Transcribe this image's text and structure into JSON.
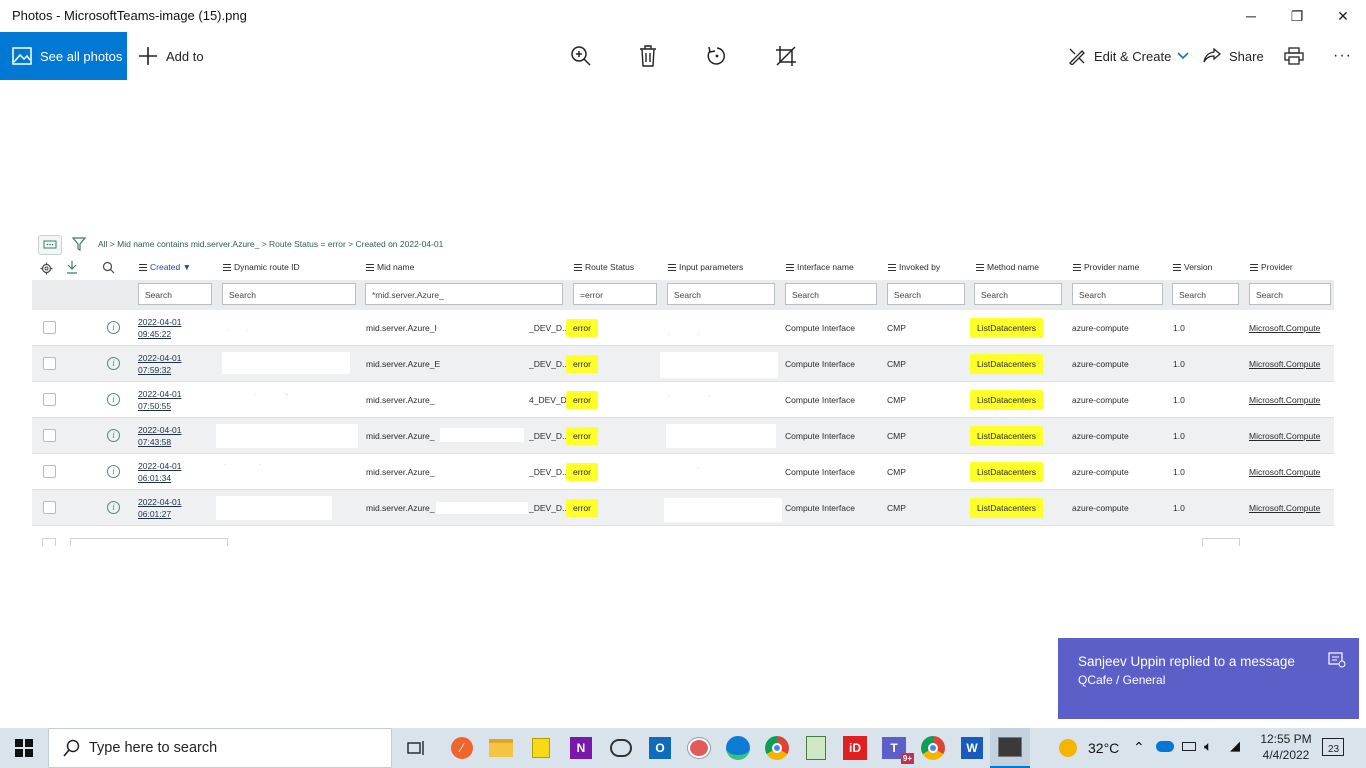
{
  "window": {
    "title": "Photos - MicrosoftTeams-image (15).png",
    "minimize_glyph": "─",
    "maximize_glyph": "❐",
    "close_glyph": "✕"
  },
  "toolbar": {
    "see_all_label": "See all photos",
    "add_to_label": "Add to",
    "edit_create_label": "Edit & Create",
    "share_label": "Share",
    "more_glyph": "···",
    "icons": [
      "zoom-icon",
      "delete-icon",
      "rotate-icon",
      "crop-icon",
      "print-icon"
    ]
  },
  "image": {
    "breadcrumb": "All > Mid name contains mid.server.Azure_ > Route Status = error > Created on 2022-04-01",
    "columns": [
      {
        "key": "created",
        "label": "Created ▼"
      },
      {
        "key": "dynamic_route_id",
        "label": "Dynamic route ID"
      },
      {
        "key": "mid_name",
        "label": "Mid name"
      },
      {
        "key": "route_status",
        "label": "Route Status"
      },
      {
        "key": "input_parameters",
        "label": "Input parameters"
      },
      {
        "key": "interface_name",
        "label": "Interface name"
      },
      {
        "key": "invoked_by",
        "label": "Invoked by"
      },
      {
        "key": "method_name",
        "label": "Method name"
      },
      {
        "key": "provider_name",
        "label": "Provider name"
      },
      {
        "key": "version",
        "label": "Version"
      },
      {
        "key": "provider",
        "label": "Provider"
      }
    ],
    "search": {
      "created": "Search",
      "dynamic_route_id": "Search",
      "mid_name": "*mid.server.Azure_",
      "route_status": "=error",
      "input_parameters": "Search",
      "interface_name": "Search",
      "invoked_by": "Search",
      "method_name": "Search",
      "provider_name": "Search",
      "version": "Search",
      "provider": "Search"
    },
    "rows": [
      {
        "date": "2022-04-01",
        "time": "09:45:22",
        "mid": "mid.server.Azure_I",
        "mid_end": "_DEV_D...",
        "status": "error",
        "iface": "Compute Interface",
        "invoked": "CMP",
        "method": "ListDatacenters",
        "pname": "azure-compute",
        "version": "1.0",
        "provider": "Microsoft.Compute"
      },
      {
        "date": "2022-04-01",
        "time": "07:59:32",
        "mid": "mid.server.Azure_E",
        "mid_end": "_DEV_D...",
        "status": "error",
        "iface": "Compute Interface",
        "invoked": "CMP",
        "method": "ListDatacenters",
        "pname": "azure-compute",
        "version": "1.0",
        "provider": "Microsoft.Compute"
      },
      {
        "date": "2022-04-01",
        "time": "07:50:55",
        "mid": "mid.server.Azure_",
        "mid_end": "4_DEV_D...",
        "status": "error",
        "iface": "Compute Interface",
        "invoked": "CMP",
        "method": "ListDatacenters",
        "pname": "azure-compute",
        "version": "1.0",
        "provider": "Microsoft.Compute"
      },
      {
        "date": "2022-04-01",
        "time": "07:43:58",
        "mid": "mid.server.Azure_",
        "mid_end": "_DEV_D...",
        "status": "error",
        "iface": "Compute Interface",
        "invoked": "CMP",
        "method": "ListDatacenters",
        "pname": "azure-compute",
        "version": "1.0",
        "provider": "Microsoft.Compute"
      },
      {
        "date": "2022-04-01",
        "time": "06:01:34",
        "mid": "mid.server.Azure_",
        "mid_end": "_DEV_D...",
        "status": "error",
        "iface": "Compute Interface",
        "invoked": "CMP",
        "method": "ListDatacenters",
        "pname": "azure-compute",
        "version": "1.0",
        "provider": "Microsoft.Compute"
      },
      {
        "date": "2022-04-01",
        "time": "06:01:27",
        "mid": "mid.server.Azure_",
        "mid_end": "_DEV_D...",
        "status": "error",
        "iface": "Compute Interface",
        "invoked": "CMP",
        "method": "ListDatacenters",
        "pname": "azure-compute",
        "version": "1.0",
        "provider": "Microsoft.Compute"
      }
    ]
  },
  "toast": {
    "line1": "Sanjeev Uppin replied to a message",
    "line2": "QCafe / General"
  },
  "taskbar": {
    "search_placeholder": "Type here to search",
    "weather": "32°C",
    "time": "12:55 PM",
    "date": "4/4/2022",
    "notif_count": "23",
    "teams_badge": "9+"
  },
  "colors": {
    "accent": "#0078d4",
    "highlight": "#ffff2a",
    "toast": "#5b5fc7",
    "taskbar": "#d9e3ec"
  }
}
